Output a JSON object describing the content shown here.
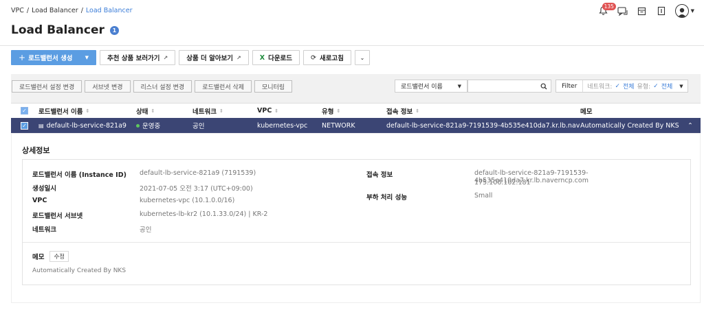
{
  "breadcrumb": [
    "VPC",
    "Load Balancer",
    "Load Balancer"
  ],
  "breadcrumb_sep": "/",
  "notification_count": "135",
  "page_title": "Load Balancer",
  "help_icon": "1",
  "actions": {
    "create": "로드밸런서 생성",
    "recommend": "추천 상품 보러가기",
    "learn_more": "상품 더 알아보기",
    "download": "다운로드",
    "refresh": "새로고침"
  },
  "sub_actions": [
    "로드밸런서 설정 변경",
    "서브넷 변경",
    "리스너 설정 변경",
    "로드밸런서 삭제",
    "모니터링"
  ],
  "search": {
    "select_value": "로드밸런서 이름",
    "filter_label": "Filter",
    "network_label": "네트워크:",
    "network_value": "전체",
    "type_label": "유형:",
    "type_value": "전체"
  },
  "table": {
    "columns": [
      "로드밸런서 이름",
      "상태",
      "네트워크",
      "VPC",
      "유형",
      "접속 정보",
      "메모"
    ],
    "row": {
      "name": "default-lb-service-821a9",
      "status": "운영중",
      "network": "공인",
      "vpc": "kubernetes-vpc",
      "type": "NETWORK",
      "access": "default-lb-service-821a9-7191539-4b535e410da7.kr.lb.naverncp.com",
      "memo": "Automatically Created By NKS"
    }
  },
  "detail": {
    "title": "상세정보",
    "left": [
      {
        "k": "로드밸런서 이름 (Instance ID)",
        "v": "default-lb-service-821a9 (7191539)"
      },
      {
        "k": "생성일시",
        "v": "2021-07-05 오전 3:17 (UTC+09:00)"
      },
      {
        "k": "VPC",
        "v": "kubernetes-vpc (10.1.0.0/16)"
      },
      {
        "k": "로드밸런서 서브넷",
        "v": "kubernetes-lb-kr2 (10.1.33.0/24) | KR-2"
      },
      {
        "k": "네트워크",
        "v": "공인"
      }
    ],
    "right": [
      {
        "k": "접속 정보",
        "v": "default-lb-service-821a9-7191539-4b535e410da7.kr.lb.naverncp.com",
        "v2": "175.106.102.181"
      },
      {
        "k": "부하 처리 성능",
        "v": "Small"
      }
    ],
    "memo_label": "메모",
    "edit_label": "수정",
    "memo_text": "Automatically Created By NKS"
  }
}
